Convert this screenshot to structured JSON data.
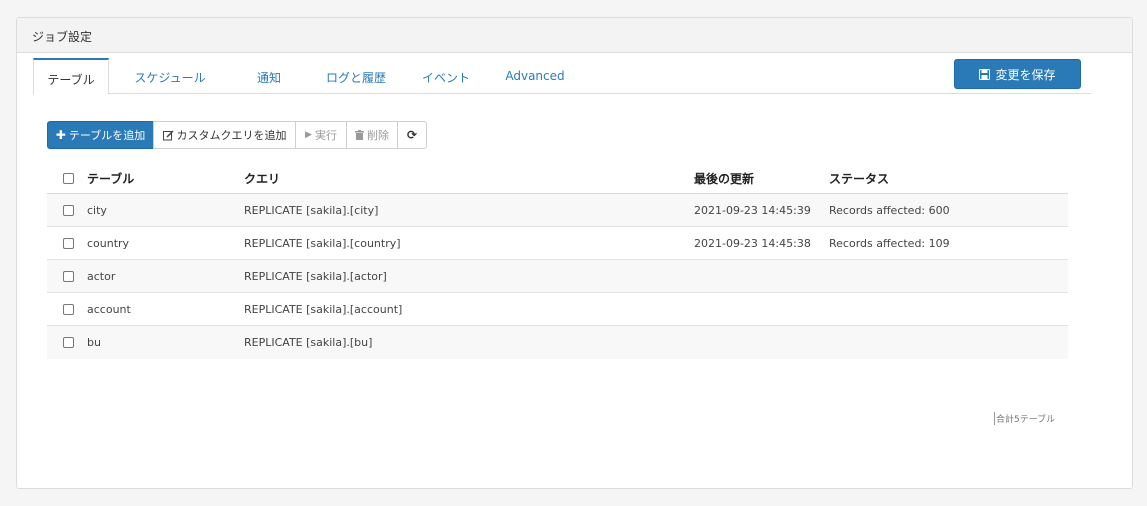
{
  "panel": {
    "title": "ジョブ設定"
  },
  "tabs": [
    {
      "label": "テーブル",
      "active": true
    },
    {
      "label": "スケジュール",
      "active": false
    },
    {
      "label": "通知",
      "active": false
    },
    {
      "label": "ログと履歴",
      "active": false
    },
    {
      "label": "イベント",
      "active": false
    },
    {
      "label": "Advanced",
      "active": false
    }
  ],
  "save_button": {
    "label": "変更を保存",
    "icon": "floppy-disk-icon"
  },
  "toolbar": {
    "add_table": "テーブルを追加",
    "add_custom_query": "カスタムクエリを追加",
    "run": "実行",
    "delete": "削除"
  },
  "table": {
    "columns": [
      "テーブル",
      "クエリ",
      "最後の更新",
      "ステータス"
    ],
    "rows": [
      {
        "table": "city",
        "query": "REPLICATE [sakila].[city]",
        "updated": "2021-09-23 14:45:39",
        "status": "Records affected: 600"
      },
      {
        "table": "country",
        "query": "REPLICATE [sakila].[country]",
        "updated": "2021-09-23 14:45:38",
        "status": "Records affected: 109"
      },
      {
        "table": "actor",
        "query": "REPLICATE [sakila].[actor]",
        "updated": "",
        "status": ""
      },
      {
        "table": "account",
        "query": "REPLICATE [sakila].[account]",
        "updated": "",
        "status": ""
      },
      {
        "table": "bu",
        "query": "REPLICATE [sakila].[bu]",
        "updated": "",
        "status": ""
      }
    ]
  },
  "footer": {
    "count_text": "合計5テーブル"
  },
  "colors": {
    "accent": "#2a7ab8",
    "header_bg": "#f3f3f3",
    "row_alt": "#f8f8f8"
  }
}
